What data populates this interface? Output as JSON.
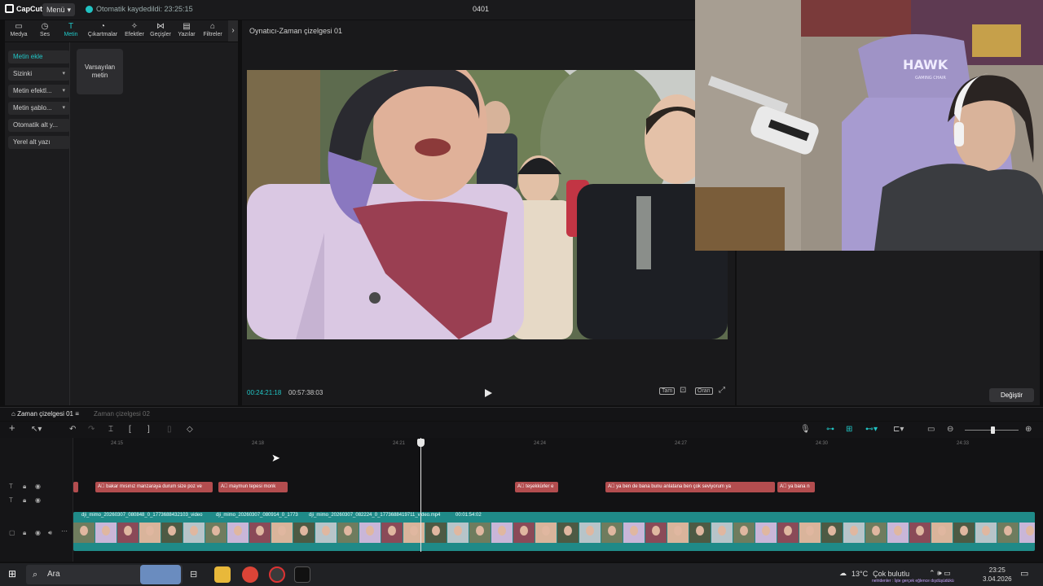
{
  "app": {
    "logo": "CapCut",
    "menu_label": "Menü",
    "autosave": "Otomatik kaydedildi: 23:25:15",
    "project_title": "0401"
  },
  "toolbar": {
    "tools": [
      "Medya",
      "Ses",
      "Metin",
      "Çıkartmalar",
      "Efektler",
      "Geçişler",
      "Yazılar",
      "Filtreler"
    ],
    "active": "Metin"
  },
  "text_panel": {
    "side_items": [
      "Metin ekle",
      "Sizinki",
      "Metin efektl...",
      "Metin şablo...",
      "Otomatik alt y...",
      "Yerel alt yazı"
    ],
    "default_text": "Varsayılan metin"
  },
  "player": {
    "title": "Oynatıcı-Zaman çizelgesi 01",
    "current_time": "00:24:21:18",
    "total_time": "00:57:38:03",
    "quality_label": "Tam",
    "ratio_label": "Oran"
  },
  "right_panel": {
    "change_button": "Değiştir"
  },
  "timeline": {
    "tabs": [
      "Zaman çizelgesi 01",
      "Zaman çizelgesi 02"
    ],
    "ruler": [
      "24:15",
      "24:18",
      "24:21",
      "24:24",
      "24:27",
      "24:30",
      "24:33"
    ],
    "subtitles": [
      "bakar mısınız manzaraya durum size poz ve",
      "maymun tepesi monk",
      "teşekkürler e",
      "ya ben de bana bunu anlatana ben çok seviyorum ya",
      "ya bana n"
    ],
    "video_clips": [
      "dji_mimo_20260307_080848_0_1773688432103_video",
      "dji_mimo_20260307_080914_0_1773",
      "dji_mimo_20260307_082224_0_1773688419711_video.mp4",
      "00:01:54:02"
    ]
  },
  "taskbar": {
    "search_placeholder": "Ara",
    "weather": "13°C",
    "weather_desc": "Çok bulutlu",
    "time": "23:25",
    "date": "3.04.2026",
    "ticker": "nelridenler : İşte gerçek eğlence dışdüşüdükü"
  },
  "webcam": {
    "chair_brand": "HAWK",
    "chair_sub": "GAMING CHAIR"
  }
}
